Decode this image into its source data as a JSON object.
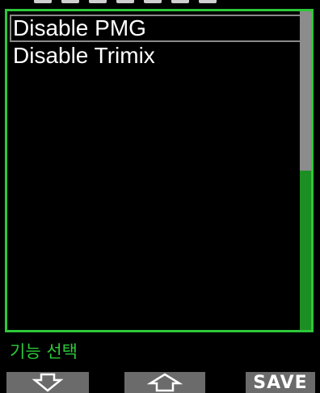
{
  "menu": {
    "items": [
      {
        "label": "Disable PMG",
        "selected": true
      },
      {
        "label": "Disable Trimix",
        "selected": false
      }
    ],
    "scroll_fraction": 0.5
  },
  "status": {
    "text": "기능 선택"
  },
  "softkeys": {
    "left_icon": "arrow-down-icon",
    "middle_icon": "arrow-up-icon",
    "right_label": "SAVE"
  },
  "colors": {
    "accent": "#2dc83a",
    "background": "#000000",
    "softkey_bg": "#6b6b6b",
    "scroll_thumb": "#8c8c8c",
    "scroll_track": "#1c8f23"
  }
}
